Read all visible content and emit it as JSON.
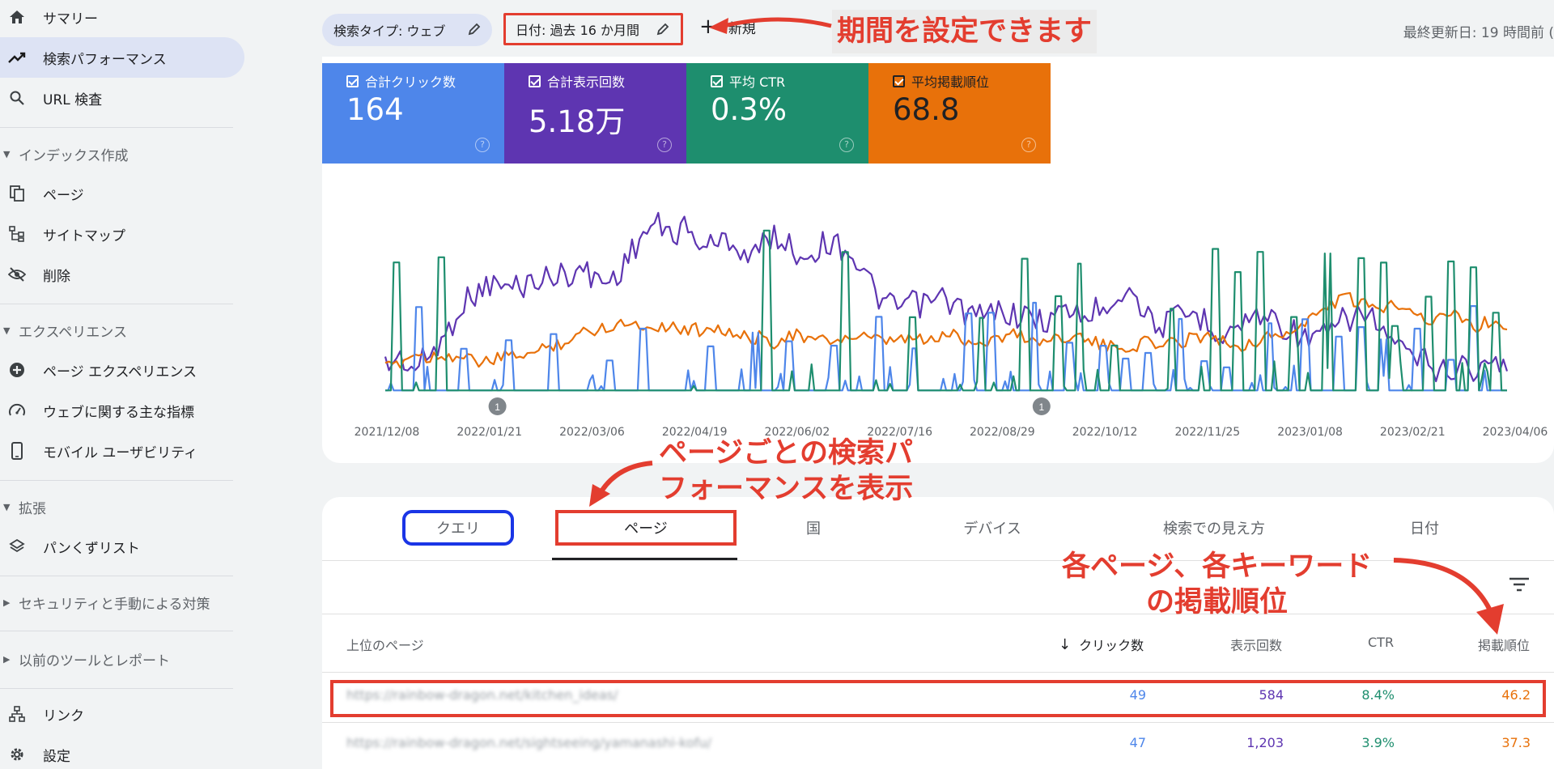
{
  "sidebar": {
    "items": [
      {
        "label": "サマリー"
      },
      {
        "label": "検索パフォーマンス"
      },
      {
        "label": "URL 検査"
      },
      {
        "label": "ページ"
      },
      {
        "label": "サイトマップ"
      },
      {
        "label": "削除"
      },
      {
        "label": "ページ エクスペリエンス"
      },
      {
        "label": "ウェブに関する主な指標"
      },
      {
        "label": "モバイル ユーザビリティ"
      },
      {
        "label": "パンくずリスト"
      },
      {
        "label": "リンク"
      },
      {
        "label": "設定"
      }
    ],
    "sections": [
      {
        "label": "インデックス作成"
      },
      {
        "label": "エクスペリエンス"
      },
      {
        "label": "拡張"
      },
      {
        "label": "セキュリティと手動による対策"
      },
      {
        "label": "以前のツールとレポート"
      }
    ]
  },
  "topbar": {
    "search_type": "検索タイプ: ウェブ",
    "date_filter": "日付: 過去 16 か月間",
    "new_label": "新規",
    "last_updated": "最終更新日: 19 時間前 ("
  },
  "metrics": [
    {
      "label": "合計クリック数",
      "value": "164",
      "color": "#4e86ea"
    },
    {
      "label": "合計表示回数",
      "value": "5.18万",
      "color": "#5e35b1"
    },
    {
      "label": "平均 CTR",
      "value": "0.3%",
      "color": "#1e8e6e"
    },
    {
      "label": "平均掲載順位",
      "value": "68.8",
      "color": "#e8710a"
    }
  ],
  "chart_data": {
    "type": "line",
    "x_tick_labels": [
      "2021/12/08",
      "2022/01/21",
      "2022/03/06",
      "2022/04/19",
      "2022/06/02",
      "2022/07/16",
      "2022/08/29",
      "2022/10/12",
      "2022/11/25",
      "2023/01/08",
      "2023/02/21",
      "2023/04/06"
    ],
    "annotations": [
      "1",
      "1"
    ],
    "series": [
      {
        "color": "#5e35b1",
        "shape": [
          0.86,
          0.82,
          0.88,
          0.8,
          0.72,
          0.56,
          0.5,
          0.45,
          0.47,
          0.46,
          0.43,
          0.42,
          0.4,
          0.38,
          0.42,
          0.44,
          0.35,
          0.22,
          0.15,
          0.2,
          0.17,
          0.24,
          0.26,
          0.22,
          0.3,
          0.28,
          0.2,
          0.26,
          0.32,
          0.26,
          0.24,
          0.28,
          0.4,
          0.52,
          0.58,
          0.54,
          0.56,
          0.52,
          0.55,
          0.6,
          0.62,
          0.58,
          0.6,
          0.62,
          0.64,
          0.6,
          0.58,
          0.62,
          0.55,
          0.5,
          0.48,
          0.62,
          0.66,
          0.62,
          0.6,
          0.64,
          0.7,
          0.66,
          0.62,
          0.6,
          0.66,
          0.7,
          0.74,
          0.7,
          0.64,
          0.6,
          0.62,
          0.72,
          0.8,
          0.82,
          0.86,
          0.9,
          0.84,
          0.9,
          0.84,
          0.88
        ]
      },
      {
        "color": "#e8710a",
        "shape": [
          0.88,
          0.84,
          0.8,
          0.82,
          0.8,
          0.82,
          0.84,
          0.84,
          0.82,
          0.8,
          0.8,
          0.76,
          0.74,
          0.7,
          0.68,
          0.66,
          0.64,
          0.66,
          0.66,
          0.66,
          0.68,
          0.68,
          0.66,
          0.7,
          0.72,
          0.72,
          0.74,
          0.7,
          0.72,
          0.74,
          0.73,
          0.72,
          0.72,
          0.74,
          0.74,
          0.72,
          0.74,
          0.72,
          0.7,
          0.74,
          0.74,
          0.72,
          0.7,
          0.72,
          0.74,
          0.72,
          0.7,
          0.74,
          0.76,
          0.78,
          0.76,
          0.74,
          0.76,
          0.74,
          0.72,
          0.7,
          0.74,
          0.76,
          0.74,
          0.72,
          0.7,
          0.68,
          0.62,
          0.56,
          0.52,
          0.54,
          0.58,
          0.56,
          0.54,
          0.6,
          0.64,
          0.6,
          0.62,
          0.66,
          0.64,
          0.66
        ]
      },
      {
        "color": "#4e86ea",
        "spikes": [
          0.03,
          0.07,
          0.11,
          0.15,
          0.2,
          0.23,
          0.29,
          0.33,
          0.36,
          0.4,
          0.44,
          0.47,
          0.52,
          0.54,
          0.58,
          0.61,
          0.64,
          0.66,
          0.68,
          0.71,
          0.73,
          0.75,
          0.79,
          0.82,
          0.85,
          0.87,
          0.89,
          0.92,
          0.95,
          0.97
        ]
      },
      {
        "color": "#1e8e6e",
        "spikes": [
          0.01,
          0.05,
          0.34,
          0.41,
          0.47,
          0.53,
          0.57,
          0.6,
          0.62,
          0.65,
          0.7,
          0.74,
          0.76,
          0.78,
          0.81,
          0.84,
          0.87,
          0.89,
          0.9,
          0.93,
          0.95,
          0.97,
          0.99
        ]
      }
    ]
  },
  "tabs": [
    {
      "label": "クエリ"
    },
    {
      "label": "ページ"
    },
    {
      "label": "国"
    },
    {
      "label": "デバイス"
    },
    {
      "label": "検索での見え方"
    },
    {
      "label": "日付"
    }
  ],
  "table": {
    "columns": [
      "上位のページ",
      "クリック数",
      "表示回数",
      "CTR",
      "掲載順位"
    ],
    "rows": [
      {
        "page": "https://rainbow-dragon.net/kitchen_ideas/",
        "clicks": "49",
        "impressions": "584",
        "ctr": "8.4%",
        "position": "46.2"
      },
      {
        "page": "https://rainbow-dragon.net/sightseeing/yamanashi-kofu/",
        "clicks": "47",
        "impressions": "1,203",
        "ctr": "3.9%",
        "position": "37.3"
      }
    ]
  },
  "annotations": {
    "date_note": "期間を設定できます",
    "page_note_1": "ページごとの検索パ",
    "page_note_2": "フォーマンスを表示",
    "rank_note_1": "各ページ、各キーワード",
    "rank_note_2": "の掲載順位"
  },
  "colors": {
    "annotation_red": "#e33d2f",
    "annotation_blue": "#1a35e6"
  }
}
